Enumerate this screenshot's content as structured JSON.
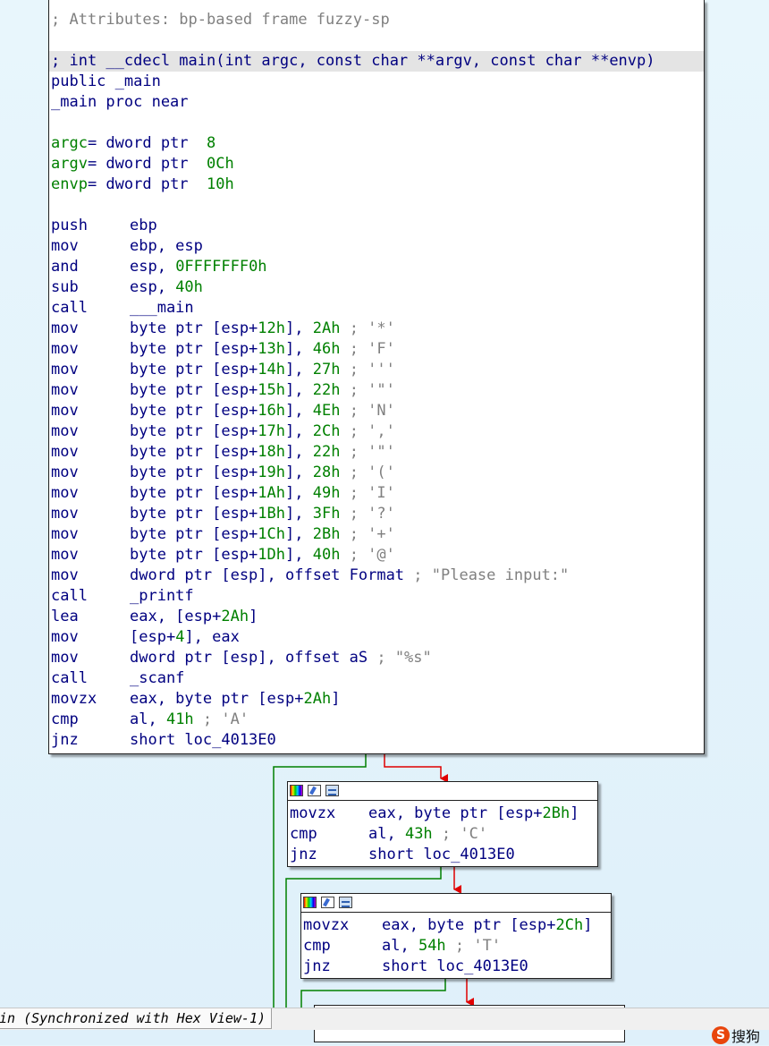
{
  "main_block": {
    "lines": [
      {
        "t": "comment",
        "text": "; Attributes: bp-based frame fuzzy-sp"
      },
      {
        "t": "blank"
      },
      {
        "t": "comment-hl",
        "text": "; int __cdecl main(int argc, const char **argv, const char **envp)"
      },
      {
        "t": "plain",
        "text": "public _main"
      },
      {
        "t": "plain",
        "text": "_main proc near"
      },
      {
        "t": "blank"
      },
      {
        "t": "var",
        "name": "argc",
        "rest": "= dword ptr  ",
        "val": "8"
      },
      {
        "t": "var",
        "name": "argv",
        "rest": "= dword ptr  ",
        "val": "0Ch"
      },
      {
        "t": "var",
        "name": "envp",
        "rest": "= dword ptr  ",
        "val": "10h"
      },
      {
        "t": "blank"
      },
      {
        "t": "ins",
        "m": "push",
        "parts": [
          [
            "b",
            "ebp"
          ]
        ]
      },
      {
        "t": "ins",
        "m": "mov",
        "parts": [
          [
            "b",
            "ebp, esp"
          ]
        ]
      },
      {
        "t": "ins",
        "m": "and",
        "parts": [
          [
            "b",
            "esp, "
          ],
          [
            "g",
            "0FFFFFFF0h"
          ]
        ]
      },
      {
        "t": "ins",
        "m": "sub",
        "parts": [
          [
            "b",
            "esp, "
          ],
          [
            "g",
            "40h"
          ]
        ]
      },
      {
        "t": "ins",
        "m": "call",
        "parts": [
          [
            "b",
            "___main"
          ]
        ]
      },
      {
        "t": "ins",
        "m": "mov",
        "parts": [
          [
            "b",
            "byte ptr [esp+"
          ],
          [
            "g",
            "12h"
          ],
          [
            "b",
            "], "
          ],
          [
            "g",
            "2Ah"
          ],
          [
            "c",
            " ; '*'"
          ]
        ]
      },
      {
        "t": "ins",
        "m": "mov",
        "parts": [
          [
            "b",
            "byte ptr [esp+"
          ],
          [
            "g",
            "13h"
          ],
          [
            "b",
            "], "
          ],
          [
            "g",
            "46h"
          ],
          [
            "c",
            " ; 'F'"
          ]
        ]
      },
      {
        "t": "ins",
        "m": "mov",
        "parts": [
          [
            "b",
            "byte ptr [esp+"
          ],
          [
            "g",
            "14h"
          ],
          [
            "b",
            "], "
          ],
          [
            "g",
            "27h"
          ],
          [
            "c",
            " ; '''"
          ]
        ]
      },
      {
        "t": "ins",
        "m": "mov",
        "parts": [
          [
            "b",
            "byte ptr [esp+"
          ],
          [
            "g",
            "15h"
          ],
          [
            "b",
            "], "
          ],
          [
            "g",
            "22h"
          ],
          [
            "c",
            " ; '\"'"
          ]
        ]
      },
      {
        "t": "ins",
        "m": "mov",
        "parts": [
          [
            "b",
            "byte ptr [esp+"
          ],
          [
            "g",
            "16h"
          ],
          [
            "b",
            "], "
          ],
          [
            "g",
            "4Eh"
          ],
          [
            "c",
            " ; 'N'"
          ]
        ]
      },
      {
        "t": "ins",
        "m": "mov",
        "parts": [
          [
            "b",
            "byte ptr [esp+"
          ],
          [
            "g",
            "17h"
          ],
          [
            "b",
            "], "
          ],
          [
            "g",
            "2Ch"
          ],
          [
            "c",
            " ; ','"
          ]
        ]
      },
      {
        "t": "ins",
        "m": "mov",
        "parts": [
          [
            "b",
            "byte ptr [esp+"
          ],
          [
            "g",
            "18h"
          ],
          [
            "b",
            "], "
          ],
          [
            "g",
            "22h"
          ],
          [
            "c",
            " ; '\"'"
          ]
        ]
      },
      {
        "t": "ins",
        "m": "mov",
        "parts": [
          [
            "b",
            "byte ptr [esp+"
          ],
          [
            "g",
            "19h"
          ],
          [
            "b",
            "], "
          ],
          [
            "g",
            "28h"
          ],
          [
            "c",
            " ; '('"
          ]
        ]
      },
      {
        "t": "ins",
        "m": "mov",
        "parts": [
          [
            "b",
            "byte ptr [esp+"
          ],
          [
            "g",
            "1Ah"
          ],
          [
            "b",
            "], "
          ],
          [
            "g",
            "49h"
          ],
          [
            "c",
            " ; 'I'"
          ]
        ]
      },
      {
        "t": "ins",
        "m": "mov",
        "parts": [
          [
            "b",
            "byte ptr [esp+"
          ],
          [
            "g",
            "1Bh"
          ],
          [
            "b",
            "], "
          ],
          [
            "g",
            "3Fh"
          ],
          [
            "c",
            " ; '?'"
          ]
        ]
      },
      {
        "t": "ins",
        "m": "mov",
        "parts": [
          [
            "b",
            "byte ptr [esp+"
          ],
          [
            "g",
            "1Ch"
          ],
          [
            "b",
            "], "
          ],
          [
            "g",
            "2Bh"
          ],
          [
            "c",
            " ; '+'"
          ]
        ]
      },
      {
        "t": "ins",
        "m": "mov",
        "parts": [
          [
            "b",
            "byte ptr [esp+"
          ],
          [
            "g",
            "1Dh"
          ],
          [
            "b",
            "], "
          ],
          [
            "g",
            "40h"
          ],
          [
            "c",
            " ; '@'"
          ]
        ]
      },
      {
        "t": "ins",
        "m": "mov",
        "parts": [
          [
            "b",
            "dword ptr [esp], offset Format"
          ],
          [
            "c",
            " ; \"Please input:\""
          ]
        ]
      },
      {
        "t": "ins",
        "m": "call",
        "parts": [
          [
            "b",
            "_printf"
          ]
        ]
      },
      {
        "t": "ins",
        "m": "lea",
        "parts": [
          [
            "b",
            "eax, [esp+"
          ],
          [
            "g",
            "2Ah"
          ],
          [
            "b",
            "]"
          ]
        ]
      },
      {
        "t": "ins",
        "m": "mov",
        "parts": [
          [
            "b",
            "[esp+"
          ],
          [
            "g",
            "4"
          ],
          [
            "b",
            "], eax"
          ]
        ]
      },
      {
        "t": "ins",
        "m": "mov",
        "parts": [
          [
            "b",
            "dword ptr [esp], offset aS"
          ],
          [
            "c",
            " ; \"%s\""
          ]
        ]
      },
      {
        "t": "ins",
        "m": "call",
        "parts": [
          [
            "b",
            "_scanf"
          ]
        ]
      },
      {
        "t": "ins",
        "m": "movzx",
        "parts": [
          [
            "b",
            "eax, byte ptr [esp+"
          ],
          [
            "g",
            "2Ah"
          ],
          [
            "b",
            "]"
          ]
        ]
      },
      {
        "t": "ins",
        "m": "cmp",
        "parts": [
          [
            "b",
            "al, "
          ],
          [
            "g",
            "41h"
          ],
          [
            "c",
            " ; 'A'"
          ]
        ]
      },
      {
        "t": "ins",
        "m": "jnz",
        "parts": [
          [
            "b",
            "short loc_4013E0"
          ]
        ]
      }
    ]
  },
  "block2": {
    "lines": [
      {
        "t": "ins",
        "m": "movzx",
        "parts": [
          [
            "b",
            "eax, byte ptr [esp+"
          ],
          [
            "g",
            "2Bh"
          ],
          [
            "b",
            "]"
          ]
        ]
      },
      {
        "t": "ins",
        "m": "cmp",
        "parts": [
          [
            "b",
            "al, "
          ],
          [
            "g",
            "43h"
          ],
          [
            "c",
            " ; 'C'"
          ]
        ]
      },
      {
        "t": "ins",
        "m": "jnz",
        "parts": [
          [
            "b",
            "short loc_4013E0"
          ]
        ]
      }
    ]
  },
  "block3": {
    "lines": [
      {
        "t": "ins",
        "m": "movzx",
        "parts": [
          [
            "b",
            "eax, byte ptr [esp+"
          ],
          [
            "g",
            "2Ch"
          ],
          [
            "b",
            "]"
          ]
        ]
      },
      {
        "t": "ins",
        "m": "cmp",
        "parts": [
          [
            "b",
            "al, "
          ],
          [
            "g",
            "54h"
          ],
          [
            "c",
            " ; 'T'"
          ]
        ]
      },
      {
        "t": "ins",
        "m": "jnz",
        "parts": [
          [
            "b",
            "short loc_4013E0"
          ]
        ]
      }
    ]
  },
  "status_bar": {
    "tab_label": "in (Synchronized with Hex View-1)"
  },
  "ime": {
    "logo": "S",
    "label": "搜狗"
  },
  "colors": {
    "keyword": "#000080",
    "number": "#008000",
    "comment": "#808080",
    "edge_true": "#008000",
    "edge_false": "#e00000"
  }
}
